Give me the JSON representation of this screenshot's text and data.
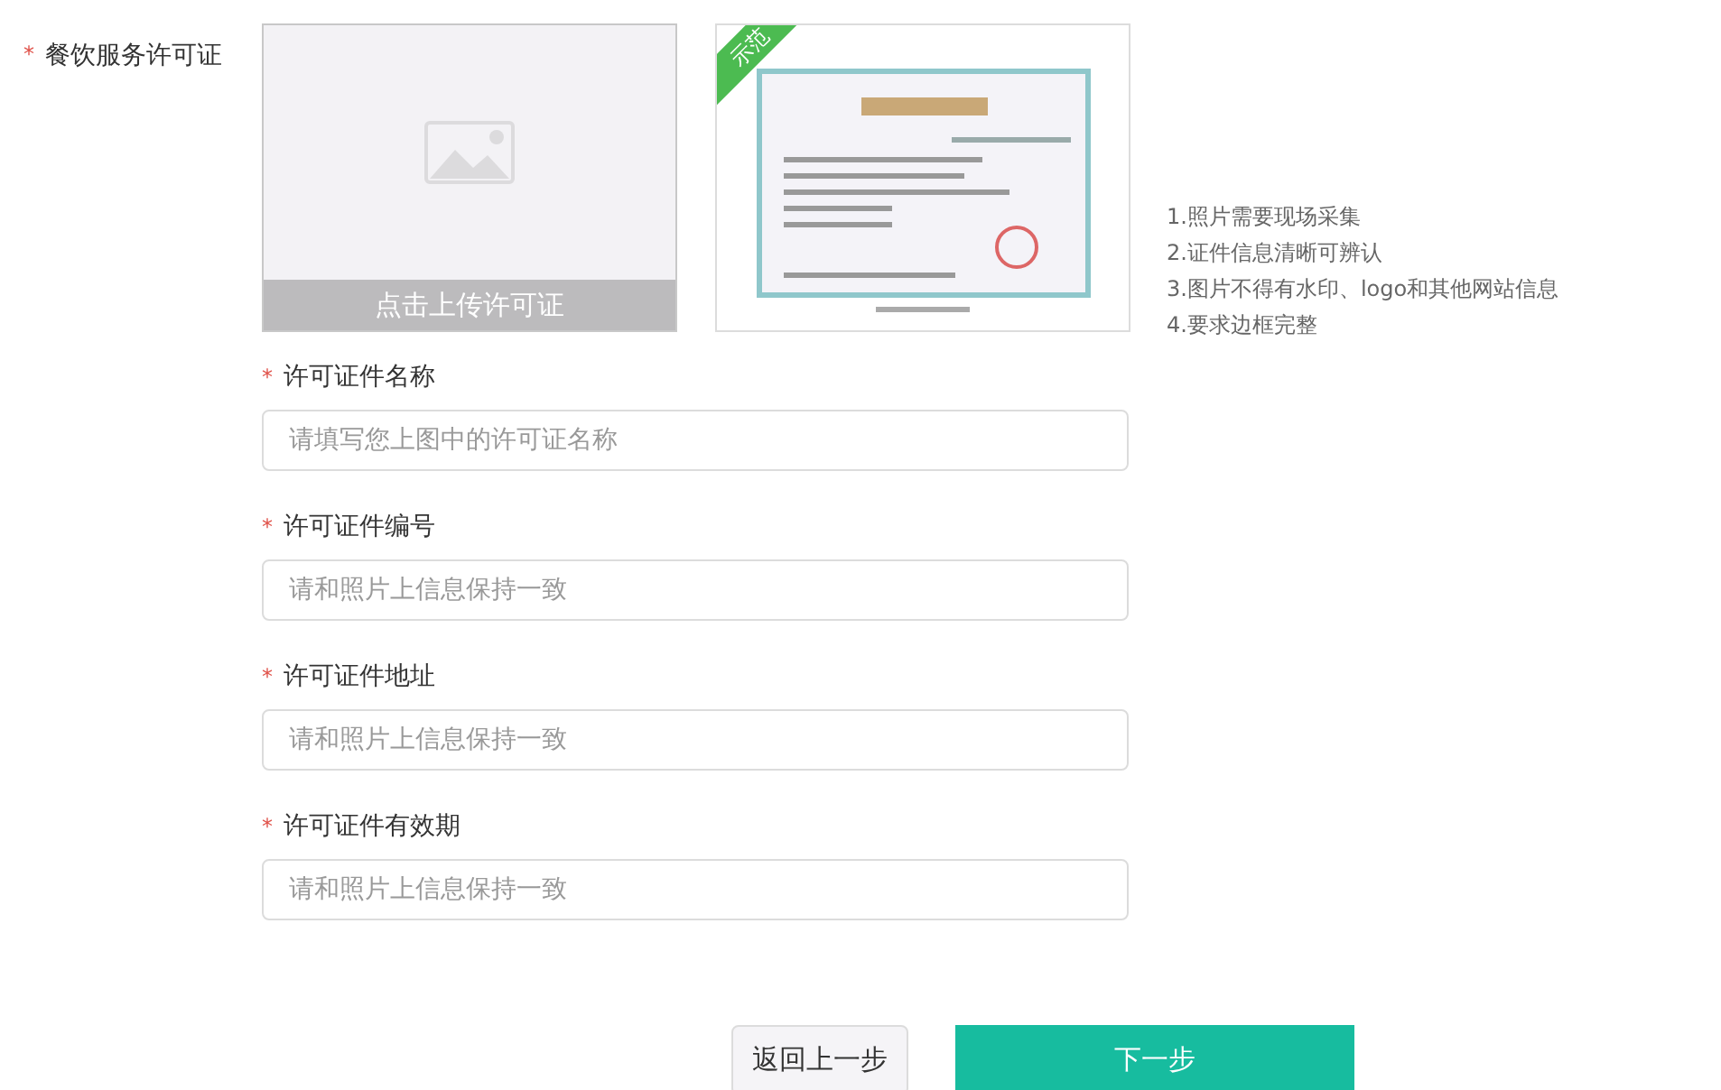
{
  "upload": {
    "required": "*",
    "label": "餐饮服务许可证",
    "upload_caption": "点击上传许可证"
  },
  "sample": {
    "badge": "示范",
    "kind": "picture"
  },
  "tips": [
    "1.照片需要现场采集",
    "2.证件信息清晰可辨认",
    "3.图片不得有水印、logo和其他网站信息",
    "4.要求边框完整"
  ],
  "fields": [
    {
      "required": "*",
      "label": "许可证件名称",
      "placeholder": "请填写您上图中的许可证名称"
    },
    {
      "required": "*",
      "label": "许可证件编号",
      "placeholder": "请和照片上信息保持一致"
    },
    {
      "required": "*",
      "label": "许可证件地址",
      "placeholder": "请和照片上信息保持一致"
    },
    {
      "required": "*",
      "label": "许可证件有效期",
      "placeholder": "请和照片上信息保持一致"
    }
  ],
  "buttons": [
    {
      "kind": "secondary",
      "label": "返回上一步"
    },
    {
      "kind": "primary",
      "label": "下一步"
    }
  ]
}
